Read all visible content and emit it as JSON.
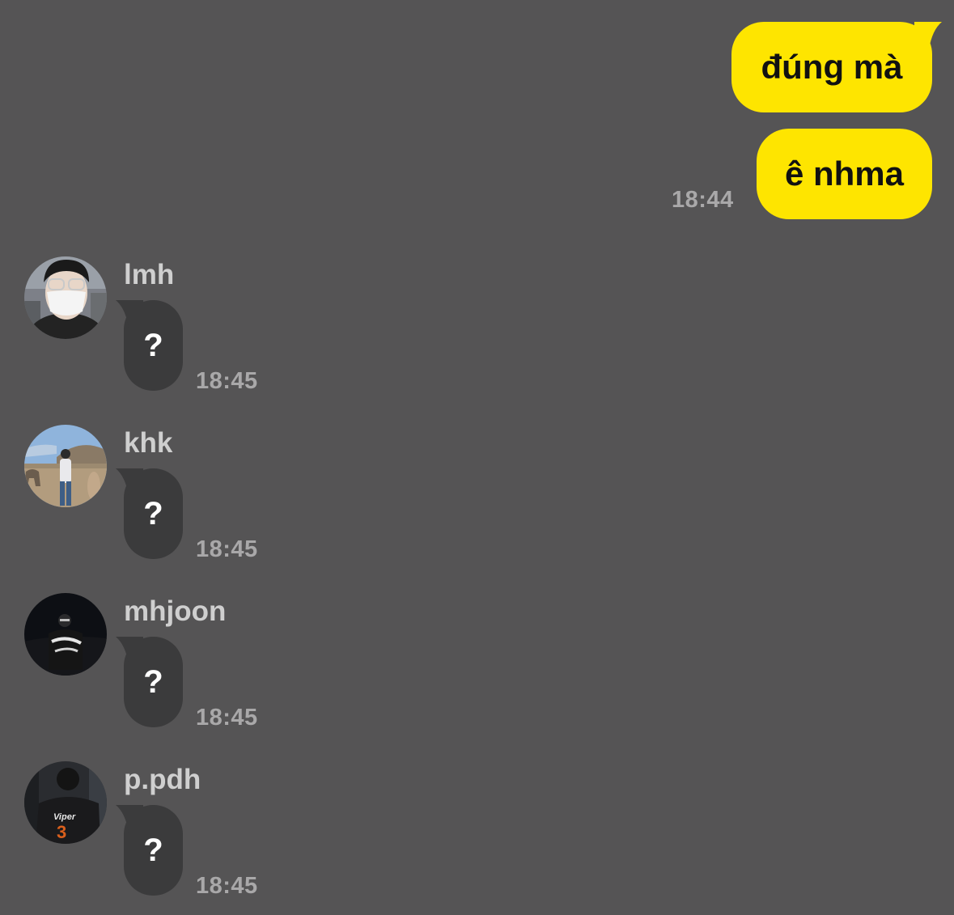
{
  "outgoing": [
    {
      "text": "đúng mà"
    },
    {
      "text": "ê nhma",
      "time": "18:44"
    }
  ],
  "incoming": [
    {
      "sender": "lmh",
      "text": "?",
      "time": "18:45",
      "avatar": "person-with-mask-and-glasses"
    },
    {
      "sender": "khk",
      "text": "?",
      "time": "18:45",
      "avatar": "person-with-alpaca-in-field"
    },
    {
      "sender": "mhjoon",
      "text": "?",
      "time": "18:45",
      "avatar": "person-in-dark"
    },
    {
      "sender": "p.pdh",
      "text": "?",
      "time": "18:45",
      "avatar": "person-in-viper-3-jersey"
    }
  ],
  "avatar_jersey": {
    "name": "Viper",
    "number": "3"
  },
  "colors": {
    "background": "#555455",
    "outgoing_bubble": "#FEE500",
    "incoming_bubble": "#3b3b3c",
    "timestamp": "#a9a8a9"
  }
}
